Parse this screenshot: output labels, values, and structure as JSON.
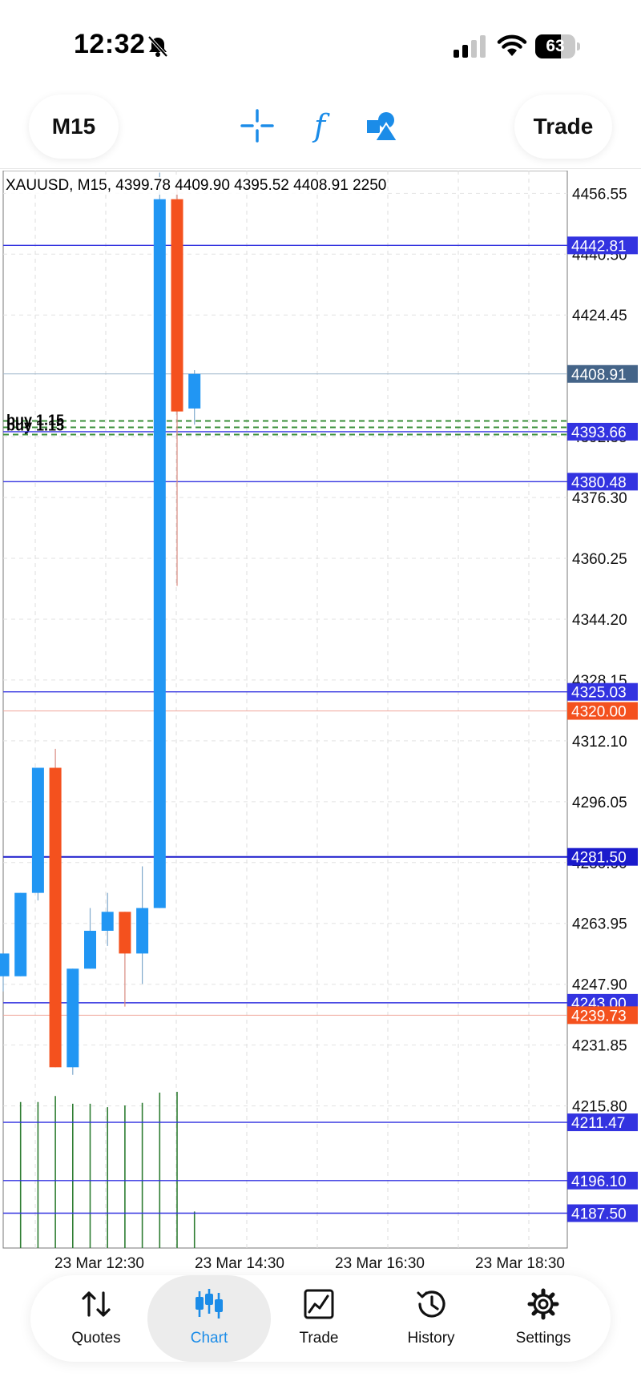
{
  "status_bar": {
    "time": "12:32",
    "battery": "63",
    "battery_level": 0.63
  },
  "toolbar": {
    "timeframe": "M15",
    "trade": "Trade"
  },
  "chart": {
    "header": "XAUUSD, M15, 4399.78 4409.90 4395.52 4408.91 2250",
    "order_labels": [
      "buy 1.15",
      "buy 1.15"
    ],
    "colors": {
      "bull": "#2196F3",
      "bear": "#F4511E",
      "level": "#3333e0",
      "current": "#446488",
      "volume": "#2e7d32"
    }
  },
  "chart_data": {
    "type": "candlestick",
    "symbol": "XAUUSD",
    "timeframe": "M15",
    "ylim": [
      4182,
      4470
    ],
    "y_ticks": [
      "4456.55",
      "4440.50",
      "4424.45",
      "4392.35",
      "4376.30",
      "4360.25",
      "4344.20",
      "4328.15",
      "4312.10",
      "4296.05",
      "4280.00",
      "4263.95",
      "4247.90",
      "4231.85",
      "4215.80"
    ],
    "x_tick_labels": [
      "23 Mar 12:30",
      "23 Mar 14:30",
      "23 Mar 16:30",
      "23 Mar 18:30"
    ],
    "candles": [
      {
        "o": 4250,
        "h": 4256,
        "l": 4246,
        "c": 4256
      },
      {
        "o": 4250,
        "h": 4272,
        "l": 4250,
        "c": 4272
      },
      {
        "o": 4272,
        "h": 4305,
        "l": 4270,
        "c": 4305
      },
      {
        "o": 4305,
        "h": 4310,
        "l": 4226,
        "c": 4226
      },
      {
        "o": 4226,
        "h": 4252,
        "l": 4224,
        "c": 4252
      },
      {
        "o": 4252,
        "h": 4268,
        "l": 4252,
        "c": 4262
      },
      {
        "o": 4262,
        "h": 4272,
        "l": 4258,
        "c": 4267
      },
      {
        "o": 4267,
        "h": 4267,
        "l": 4242,
        "c": 4256
      },
      {
        "o": 4256,
        "h": 4279,
        "l": 4248,
        "c": 4268
      },
      {
        "o": 4268,
        "h": 4462,
        "l": 4268,
        "c": 4455
      },
      {
        "o": 4455,
        "h": 4459,
        "l": 4353,
        "c": 4399
      },
      {
        "o": 4399.78,
        "h": 4409.9,
        "l": 4395.52,
        "c": 4408.91
      }
    ],
    "volumes": [
      0,
      1720,
      1720,
      1790,
      1700,
      1700,
      1660,
      1680,
      1710,
      1830,
      1840,
      430
    ],
    "levels": [
      {
        "price": "4442.81",
        "type": "line"
      },
      {
        "price": "4408.91",
        "type": "current"
      },
      {
        "price": "4393.66",
        "type": "line"
      },
      {
        "price": "4380.48",
        "type": "line"
      },
      {
        "price": "4325.03",
        "type": "line"
      },
      {
        "price": "4320.00",
        "type": "stop"
      },
      {
        "price": "4281.50",
        "type": "line"
      },
      {
        "price": "4243.00",
        "type": "line"
      },
      {
        "price": "4239.73",
        "type": "stop"
      },
      {
        "price": "4211.47",
        "type": "line"
      },
      {
        "price": "4196.10",
        "type": "line"
      },
      {
        "price": "4187.50",
        "type": "line"
      }
    ]
  },
  "bottom_nav": [
    {
      "id": "quotes",
      "label": "Quotes",
      "active": false
    },
    {
      "id": "chart",
      "label": "Chart",
      "active": true
    },
    {
      "id": "trade",
      "label": "Trade",
      "active": false
    },
    {
      "id": "history",
      "label": "History",
      "active": false
    },
    {
      "id": "settings",
      "label": "Settings",
      "active": false
    }
  ]
}
